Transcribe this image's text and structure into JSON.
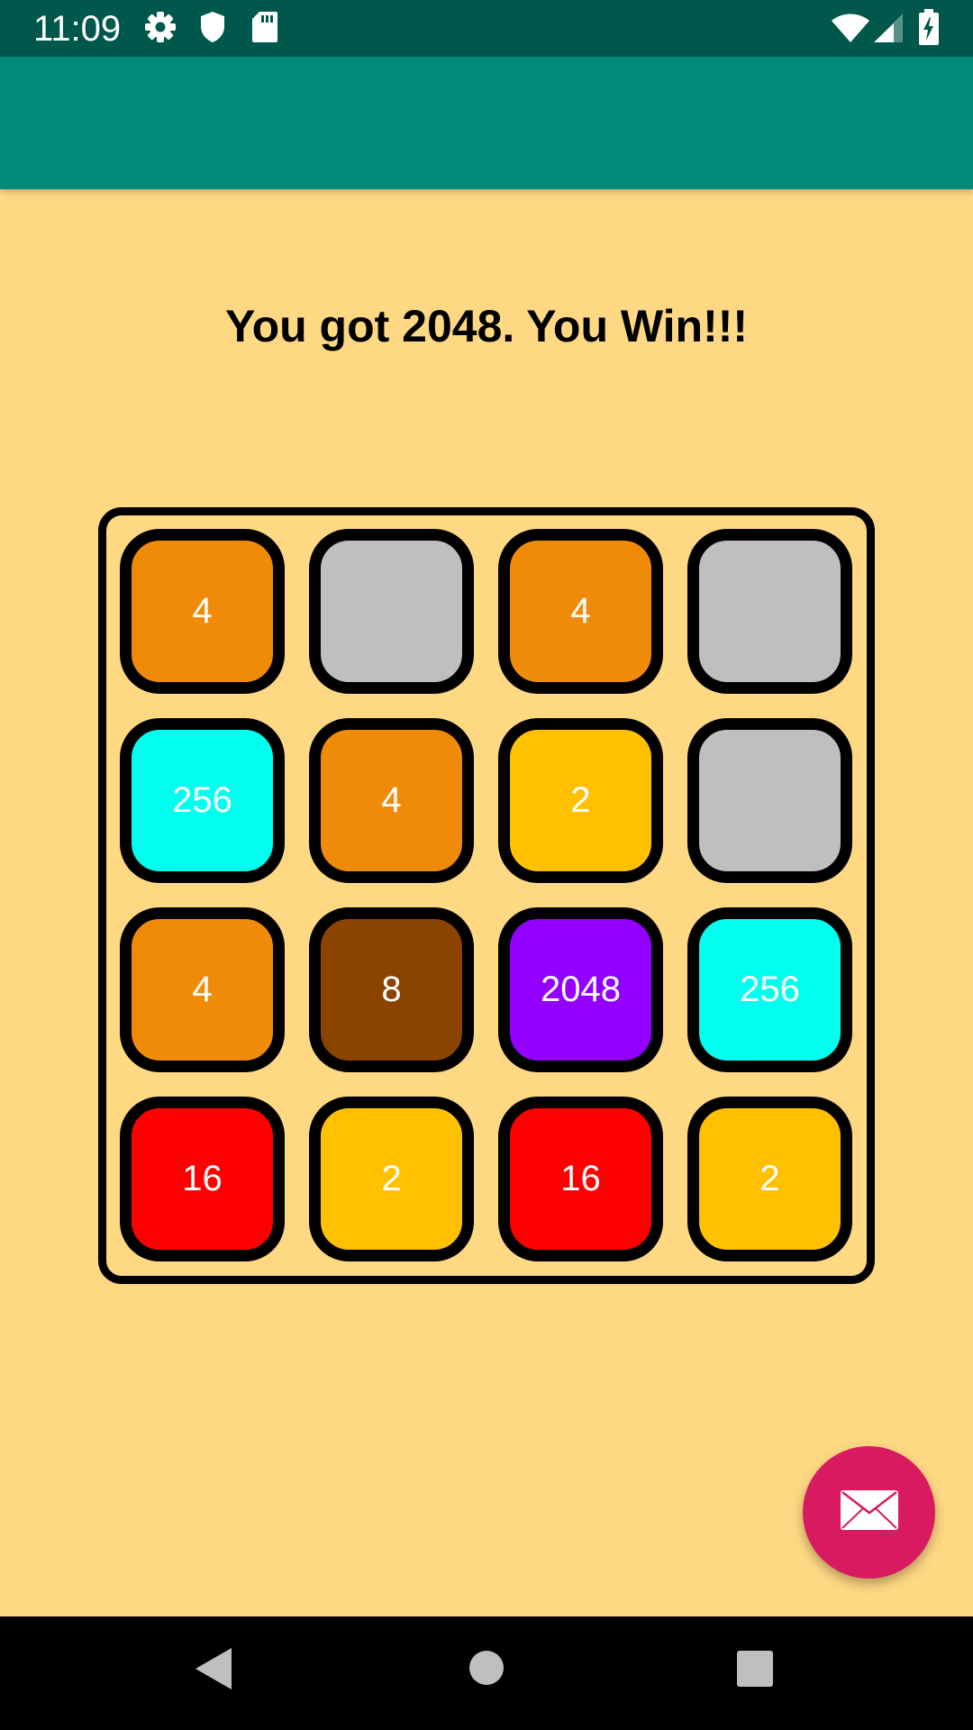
{
  "status_bar": {
    "time": "11:09",
    "icons": [
      "gear-icon",
      "shield-icon",
      "sd-card-icon",
      "wifi-icon",
      "cell-signal-icon",
      "battery-charging-icon"
    ]
  },
  "game": {
    "message": "You got 2048. You Win!!!",
    "grid": [
      [
        "4",
        "",
        "4",
        ""
      ],
      [
        "256",
        "4",
        "2",
        ""
      ],
      [
        "4",
        "8",
        "2048",
        "256"
      ],
      [
        "16",
        "2",
        "16",
        "2"
      ]
    ],
    "tile_colors": {
      "empty": "#BFBFBF",
      "2": "#FFC000",
      "4": "#EF8B08",
      "8": "#8B4300",
      "16": "#FF0000",
      "256": "#00FFEE",
      "2048": "#9300FF"
    }
  },
  "fab": {
    "icon": "mail-icon"
  },
  "nav_bar": {
    "icons": [
      "back-icon",
      "home-icon",
      "recents-icon"
    ]
  },
  "colors": {
    "status_bar": "#00574B",
    "app_bar": "#00897B",
    "background": "#FFD883",
    "fab": "#D81B60"
  }
}
